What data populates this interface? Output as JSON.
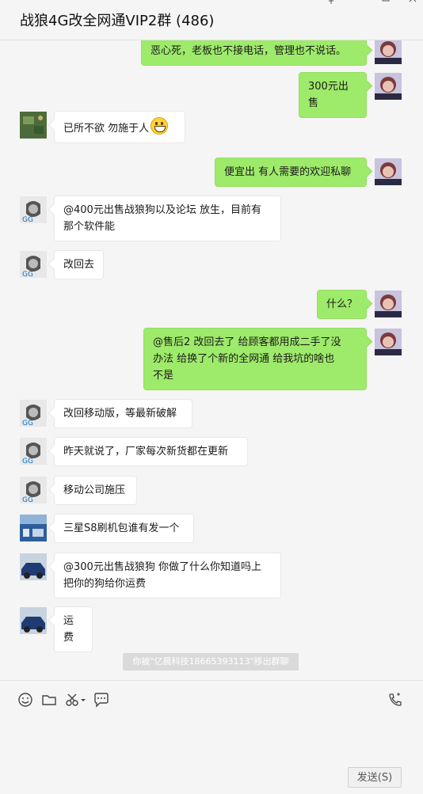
{
  "window": {
    "title": "战狼4G改全网通VIP2群 (486)",
    "controls": [
      "pin-icon",
      "minimize-icon",
      "maximize-icon",
      "close-icon"
    ]
  },
  "messages": [
    {
      "side": "right",
      "avatar": "self",
      "text": "恶心死，老板也不接电话，管理也不说话。"
    },
    {
      "side": "right",
      "avatar": "self",
      "text": "300元出售"
    },
    {
      "side": "left",
      "avatar": "game",
      "text": "已所不欲 勿施于人",
      "emoji": "grin-emoji"
    },
    {
      "side": "right",
      "avatar": "self",
      "text": "便宜出 有人需要的欢迎私聊"
    },
    {
      "side": "left",
      "avatar": "sketch",
      "text": "@400元出售战狼狗以及论坛 放生，目前有\n那个软件能"
    },
    {
      "side": "left",
      "avatar": "sketch",
      "text": "改回去"
    },
    {
      "side": "right",
      "avatar": "self",
      "text": "什么？"
    },
    {
      "side": "right",
      "avatar": "self",
      "text": "@售后2 改回去了  给顾客都用成二手了没\n办法  给换了个新的全网通    给我坑的啥也\n不是"
    },
    {
      "side": "left",
      "avatar": "sketch",
      "text": "改回移动版，等最新破解"
    },
    {
      "side": "left",
      "avatar": "sketch",
      "text": "昨天就说了，厂家每次新货都在更新"
    },
    {
      "side": "left",
      "avatar": "sketch",
      "text": "移动公司施压"
    },
    {
      "side": "left",
      "avatar": "store",
      "text": "三星S8刷机包谁有发一个"
    },
    {
      "side": "left",
      "avatar": "car",
      "text": "@300元出售战狼狗 你做了什么你知道吗上\n把你的狗给你运费"
    },
    {
      "side": "left",
      "avatar": "car",
      "text": "运费"
    }
  ],
  "system_notice": "你被\"亿晨科技18665393113\"移出群聊",
  "composer": {
    "tools": [
      "emoji-icon",
      "folder-icon",
      "scissors-icon",
      "chat-bubble-icon"
    ],
    "call_icon": "phone-icon",
    "input_value": "",
    "send_label": "发送(S)"
  }
}
